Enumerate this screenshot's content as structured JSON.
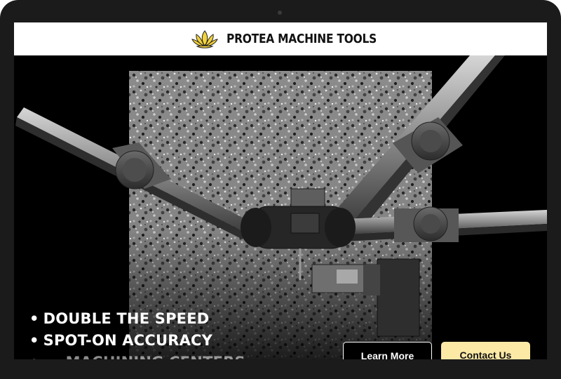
{
  "brand": {
    "name": "PROTEA MACHINE TOOLS",
    "logo_icon": "lotus-flower-icon",
    "logo_color": "#f2d23a"
  },
  "hero": {
    "features": [
      "DOUBLE THE SPEED",
      "SPOT-ON ACCURACY",
      "... MACHINING CENTERS"
    ],
    "buttons": {
      "learn_more": "Learn More",
      "contact": "Contact Us"
    }
  },
  "colors": {
    "header_bg": "#ffffff",
    "hero_bg": "#000000",
    "contact_button_bg": "#fde9a6",
    "device_frame": "#1b1b1b"
  }
}
